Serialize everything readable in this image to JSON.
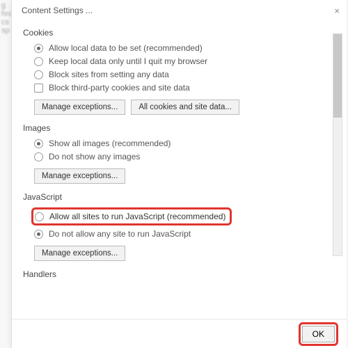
{
  "dialog": {
    "title": "Content Settings ...",
    "close_label": "×"
  },
  "cookies": {
    "heading": "Cookies",
    "allow_local": "Allow local data to be set (recommended)",
    "keep_until_quit": "Keep local data only until I quit my browser",
    "block_all": "Block sites from setting any data",
    "block_third_party": "Block third-party cookies and site data",
    "manage_exceptions": "Manage exceptions...",
    "all_cookies": "All cookies and site data..."
  },
  "images": {
    "heading": "Images",
    "show_all": "Show all images (recommended)",
    "do_not_show": "Do not show any images",
    "manage_exceptions": "Manage exceptions..."
  },
  "javascript": {
    "heading": "JavaScript",
    "allow_all": "Allow all sites to run JavaScript (recommended)",
    "block_all": "Do not allow any site to run JavaScript",
    "manage_exceptions": "Manage exceptions..."
  },
  "handlers": {
    "heading": "Handlers"
  },
  "footer": {
    "ok": "OK"
  }
}
